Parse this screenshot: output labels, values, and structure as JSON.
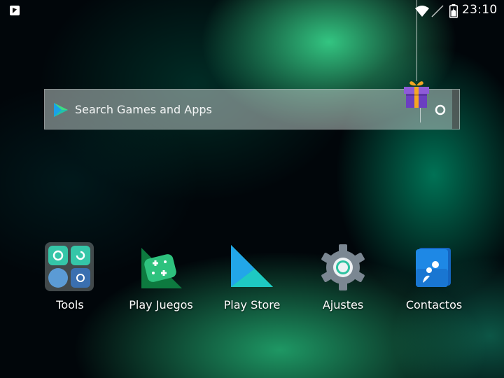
{
  "status_bar": {
    "time": "23:10",
    "icons": [
      "notification-icon",
      "wifi-icon",
      "no-signal-icon",
      "battery-charging-icon"
    ]
  },
  "search": {
    "placeholder": "Search Games and Apps",
    "icons": [
      "play-logo-icon",
      "gift-icon",
      "mic-icon"
    ]
  },
  "apps": [
    {
      "label": "Tools",
      "icon": "tools-folder-icon"
    },
    {
      "label": "Play Juegos",
      "icon": "play-games-icon"
    },
    {
      "label": "Play Store",
      "icon": "play-store-icon"
    },
    {
      "label": "Ajustes",
      "icon": "settings-gear-icon"
    },
    {
      "label": "Contactos",
      "icon": "contacts-icon"
    }
  ],
  "colors": {
    "accent_green": "#2ec27e",
    "play_blue": "#1e88e5",
    "settings_grey": "#7b8792"
  }
}
